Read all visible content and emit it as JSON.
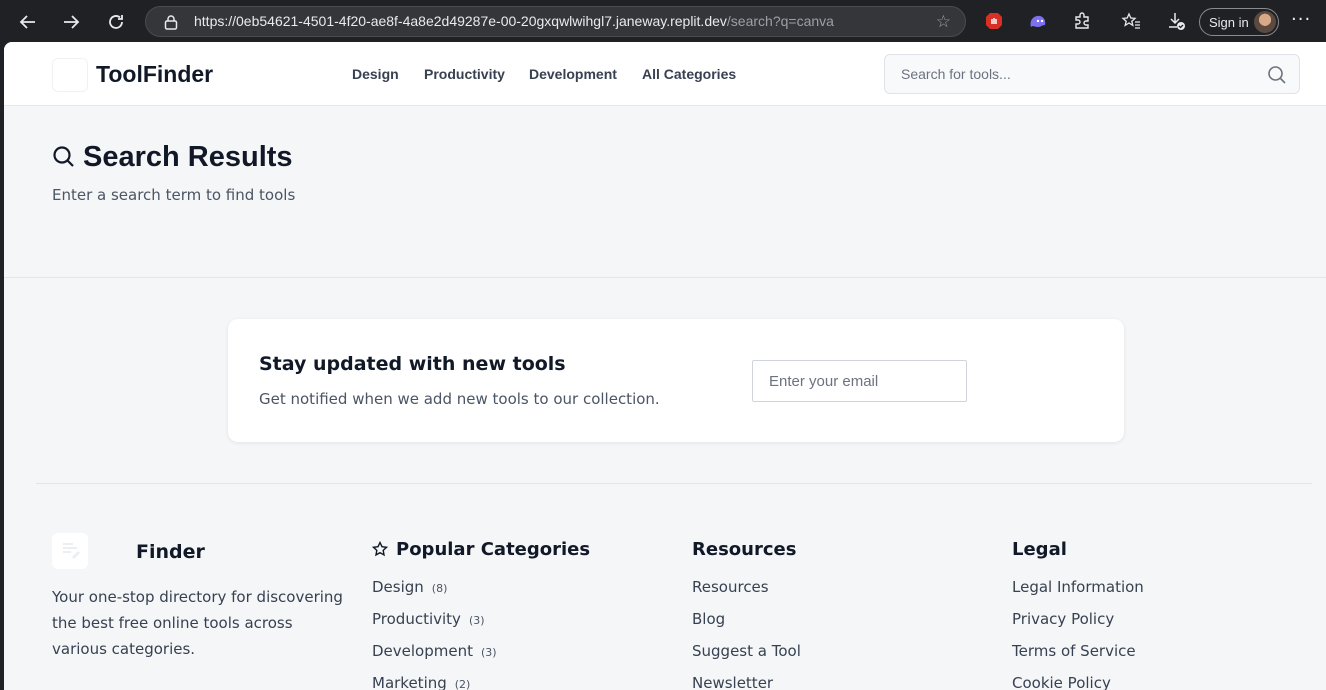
{
  "browser": {
    "url_host": "https://0eb54621-4501-4f20-ae8f-4a8e2d49287e-00-20gxqwlwihgl7.janeway.replit.dev",
    "url_path": "/search?q=canva",
    "signin_label": "Sign in"
  },
  "header": {
    "brand": "ToolFinder",
    "nav": [
      "Design",
      "Productivity",
      "Development",
      "All Categories"
    ],
    "search_placeholder": "Search for tools..."
  },
  "results": {
    "title": "Search Results",
    "subtitle": "Enter a search term to find tools"
  },
  "newsletter": {
    "title": "Stay updated with new tools",
    "subtitle": "Get notified when we add new tools to our collection.",
    "email_placeholder": "Enter your email"
  },
  "footer": {
    "brand": "Finder",
    "description": "Your one-stop directory for discovering the best free online tools across various categories.",
    "popular": {
      "title": "Popular Categories",
      "items": [
        {
          "label": "Design",
          "count": "(8)"
        },
        {
          "label": "Productivity",
          "count": "(3)"
        },
        {
          "label": "Development",
          "count": "(3)"
        },
        {
          "label": "Marketing",
          "count": "(2)"
        }
      ]
    },
    "resources": {
      "title": "Resources",
      "items": [
        "Resources",
        "Blog",
        "Suggest a Tool",
        "Newsletter"
      ]
    },
    "legal": {
      "title": "Legal",
      "items": [
        "Legal Information",
        "Privacy Policy",
        "Terms of Service",
        "Cookie Policy"
      ]
    }
  }
}
